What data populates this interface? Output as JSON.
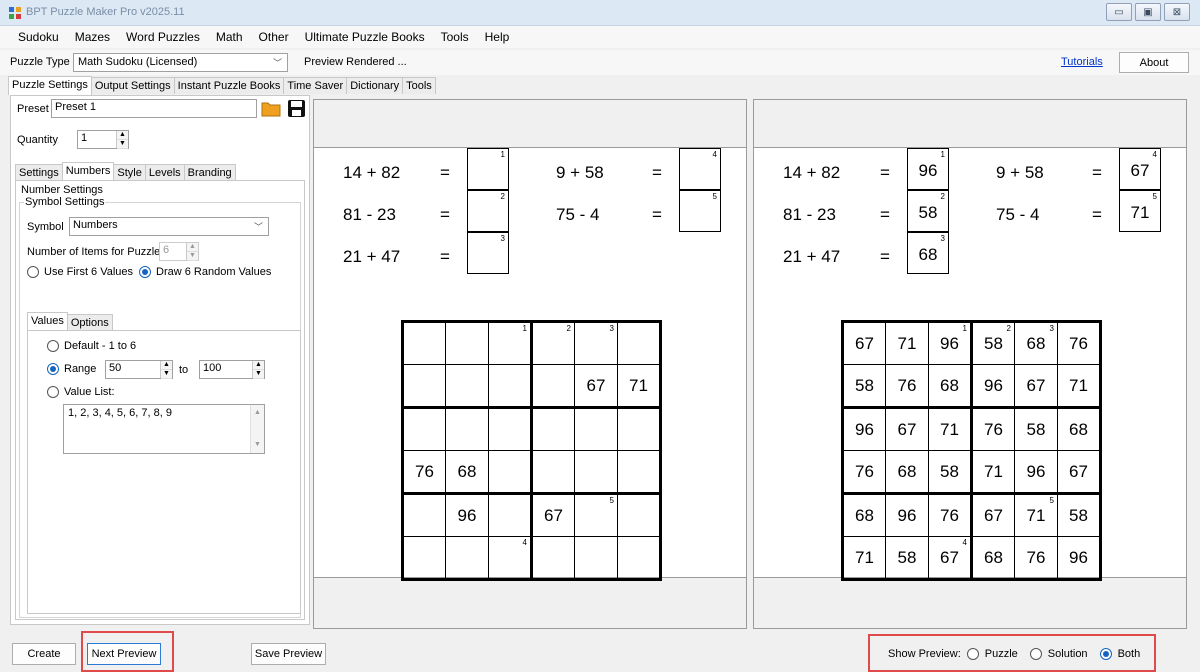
{
  "window": {
    "title": "BPT Puzzle Maker Pro v2025.11"
  },
  "menu": [
    "Sudoku",
    "Mazes",
    "Word Puzzles",
    "Math",
    "Other",
    "Ultimate Puzzle Books",
    "Tools",
    "Help"
  ],
  "toolbar": {
    "puzzle_type_label": "Puzzle Type",
    "puzzle_type_value": "Math Sudoku (Licensed)",
    "status": "Preview Rendered ...",
    "tutorials": "Tutorials",
    "about": "About"
  },
  "main_tabs": [
    "Puzzle Settings",
    "Output Settings",
    "Instant Puzzle Books",
    "Time Saver",
    "Dictionary",
    "Tools"
  ],
  "left": {
    "preset_label": "Preset",
    "preset_value": "Preset 1",
    "quantity_label": "Quantity",
    "quantity_value": "1",
    "sub_tabs": [
      "Settings",
      "Numbers",
      "Style",
      "Levels",
      "Branding"
    ],
    "number_settings": "Number Settings",
    "symbol_settings": "Symbol Settings",
    "symbol_label": "Symbol",
    "symbol_value": "Numbers",
    "items_label": "Number of Items for Puzzle:",
    "items_value": "6",
    "use_first": "Use First 6 Values",
    "draw_random": "Draw 6 Random Values",
    "inner_tabs": [
      "Values",
      "Options"
    ],
    "default_label": "Default - 1 to 6",
    "range_label": "Range",
    "range_from": "50",
    "range_to_label": "to",
    "range_to": "100",
    "value_list_label": "Value List:",
    "value_list": "1, 2, 3, 4, 5, 6, 7, 8, 9"
  },
  "equations": [
    {
      "expr": "14 + 82",
      "eq": "=",
      "num": "1",
      "answer": "96"
    },
    {
      "expr": "81 - 23",
      "eq": "=",
      "num": "2",
      "answer": "58"
    },
    {
      "expr": "21 + 47",
      "eq": "=",
      "num": "3",
      "answer": "68"
    },
    {
      "expr": "9 + 58",
      "eq": "=",
      "num": "4",
      "answer": "67"
    },
    {
      "expr": "75 - 4",
      "eq": "=",
      "num": "5",
      "answer": "71"
    }
  ],
  "puzzle_grid": [
    [
      "",
      "",
      "",
      "",
      "",
      ""
    ],
    [
      "",
      "",
      "",
      "",
      "67",
      "71"
    ],
    [
      "",
      "",
      "",
      "",
      "",
      ""
    ],
    [
      "76",
      "68",
      "",
      "",
      "",
      ""
    ],
    [
      "",
      "96",
      "",
      "67",
      "",
      ""
    ],
    [
      "",
      "",
      "",
      "",
      "",
      ""
    ]
  ],
  "solution_grid": [
    [
      "67",
      "71",
      "96",
      "58",
      "68",
      "76"
    ],
    [
      "58",
      "76",
      "68",
      "96",
      "67",
      "71"
    ],
    [
      "96",
      "67",
      "71",
      "76",
      "58",
      "68"
    ],
    [
      "76",
      "68",
      "58",
      "71",
      "96",
      "67"
    ],
    [
      "68",
      "96",
      "76",
      "67",
      "71",
      "58"
    ],
    [
      "71",
      "58",
      "67",
      "68",
      "76",
      "96"
    ]
  ],
  "grid_markers": [
    {
      "row": 0,
      "col": 2,
      "label": "1"
    },
    {
      "row": 0,
      "col": 3,
      "label": "2"
    },
    {
      "row": 0,
      "col": 4,
      "label": "3"
    },
    {
      "row": 5,
      "col": 2,
      "label": "4"
    },
    {
      "row": 4,
      "col": 4,
      "label": "5"
    }
  ],
  "bottom": {
    "create": "Create",
    "next_preview": "Next Preview",
    "save_preview": "Save Preview",
    "show_preview_label": "Show Preview:",
    "opt_puzzle": "Puzzle",
    "opt_solution": "Solution",
    "opt_both": "Both"
  },
  "colors": {
    "highlight": "#e04a4a",
    "radio_selected": "#1565c0",
    "link": "#0033cc"
  }
}
